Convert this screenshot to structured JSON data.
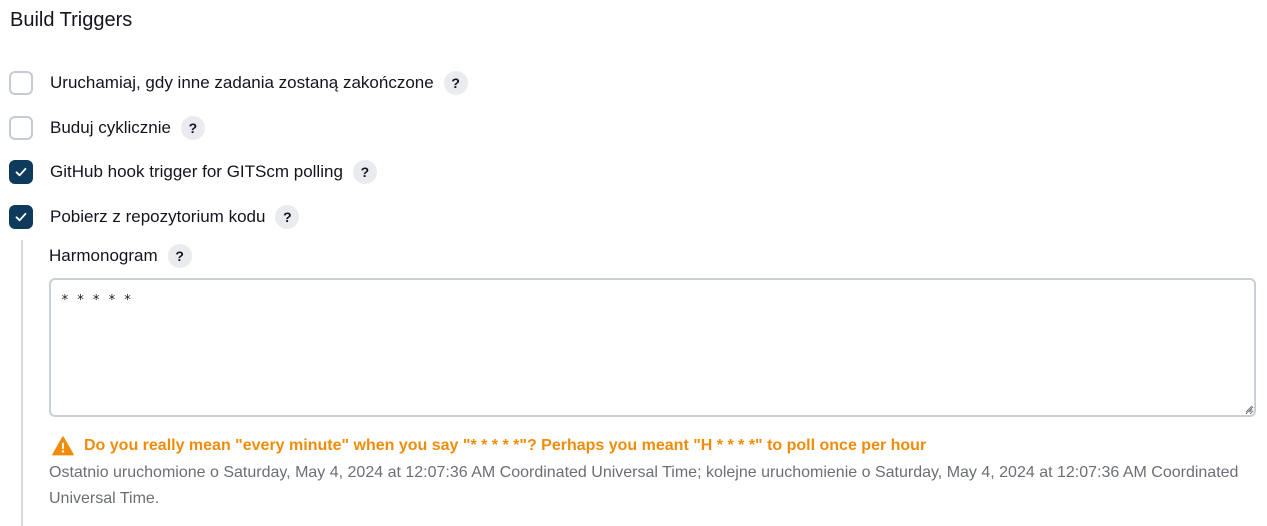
{
  "section": {
    "title": "Build Triggers"
  },
  "triggers": [
    {
      "label": "Uruchamiaj, gdy inne zadania zostaną zakończone",
      "checked": false
    },
    {
      "label": "Buduj cyklicznie",
      "checked": false
    },
    {
      "label": "GitHub hook trigger for GITScm polling",
      "checked": true
    },
    {
      "label": "Pobierz z repozytorium kodu",
      "checked": true
    }
  ],
  "help_glyph": "?",
  "schedule": {
    "label": "Harmonogram",
    "value": "* * * * *"
  },
  "warning": {
    "icon": "warning-triangle-icon",
    "text": "Do you really mean \"every minute\" when you say \"* * * * *\"? Perhaps you meant \"H * * * *\" to poll once per hour"
  },
  "info": {
    "text": "Ostatnio uruchomione o Saturday, May 4, 2024 at 12:07:36 AM Coordinated Universal Time; kolejne uruchomienie o Saturday, May 4, 2024 at 12:07:36 AM Coordinated Universal Time."
  },
  "colors": {
    "checkbox_checked": "#0e3a5c",
    "warning": "#f08c0a",
    "muted_text": "#6b6f75"
  }
}
